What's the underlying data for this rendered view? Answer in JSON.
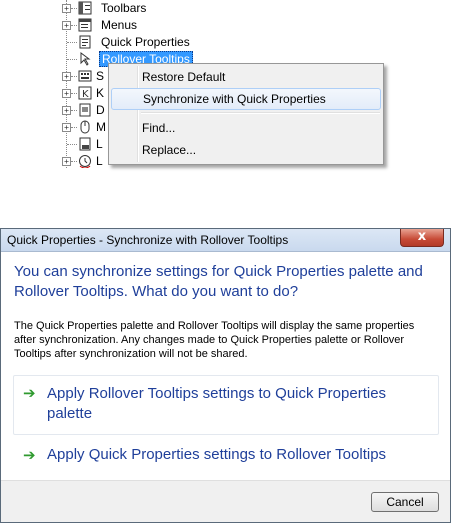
{
  "tree": {
    "items": [
      {
        "label": "Toolbars",
        "expander": "+",
        "icon": "toolbars-icon"
      },
      {
        "label": "Menus",
        "expander": "+",
        "icon": "menus-icon"
      },
      {
        "label": "Quick Properties",
        "expander": "",
        "icon": "quick-properties-icon"
      },
      {
        "label": "Rollover Tooltips",
        "expander": "",
        "icon": "rollover-tooltips-icon"
      },
      {
        "label": "S",
        "expander": "+",
        "icon": "shortcut-keys-icon"
      },
      {
        "label": "K",
        "expander": "+",
        "icon": "keyboard-icon"
      },
      {
        "label": "D",
        "expander": "+",
        "icon": "double-click-icon"
      },
      {
        "label": "M",
        "expander": "+",
        "icon": "mouse-icon"
      },
      {
        "label": "L",
        "expander": "",
        "icon": "lisp-icon"
      },
      {
        "label": "L",
        "expander": "+",
        "icon": "legacy-icon"
      }
    ]
  },
  "context_menu": {
    "items": [
      {
        "label": "Restore Default"
      },
      {
        "label": "Synchronize with Quick Properties"
      },
      {
        "label": "Find..."
      },
      {
        "label": "Replace..."
      }
    ]
  },
  "dialog": {
    "title": "Quick Properties - Synchronize with Rollover Tooltips",
    "close_label": "x",
    "heading": "You can synchronize settings for Quick Properties palette and Rollover Tooltips. What do you want to do?",
    "body": "The Quick Properties palette and Rollover Tooltips will display the same properties after synchronization. Any changes made to Quick Properties palette or Rollover Tooltips after synchronization will not be shared.",
    "option1": "Apply Rollover Tooltips settings to Quick Properties palette",
    "option2": "Apply Quick Properties settings to Rollover Tooltips",
    "arrow_glyph": "➔",
    "cancel_label": "Cancel"
  },
  "colors": {
    "instruction_text": "#1f3f9a",
    "command_arrow": "#2f9a2f",
    "selection": "#3399ff"
  }
}
